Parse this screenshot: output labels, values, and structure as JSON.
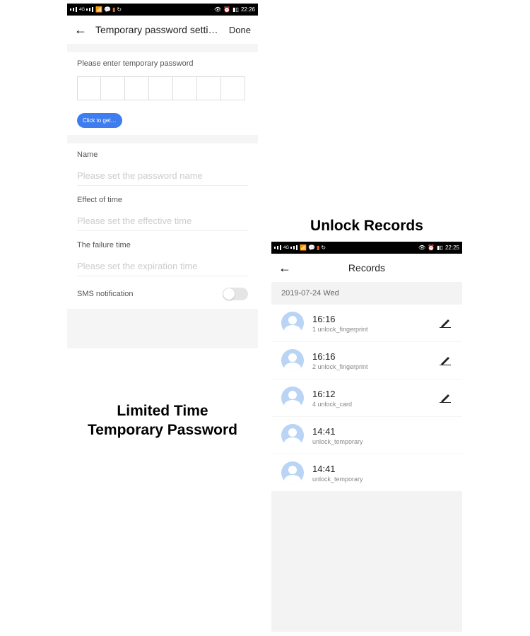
{
  "left": {
    "status": {
      "time": "22:26"
    },
    "nav": {
      "title": "Temporary password setti…",
      "done": "Done"
    },
    "prompt": "Please enter temporary password",
    "random_button": "Click to get a ran…",
    "fields": {
      "name_label": "Name",
      "name_placeholder": "Please set the password name",
      "effect_label": "Effect of time",
      "effect_placeholder": "Please set the effective time",
      "failure_label": "The failure time",
      "failure_placeholder": "Please set the expiration time",
      "sms_label": "SMS notification"
    },
    "caption": "Limited Time\nTemporary Password"
  },
  "right": {
    "caption": "Unlock Records",
    "status": {
      "time": "22:25"
    },
    "nav": {
      "title": "Records"
    },
    "date": "2019-07-24 Wed",
    "records": [
      {
        "time": "16:16",
        "type": "1 unlock_fingerprint",
        "editable": true
      },
      {
        "time": "16:16",
        "type": "2 unlock_fingerprint",
        "editable": true
      },
      {
        "time": "16:12",
        "type": "4 unlock_card",
        "editable": true
      },
      {
        "time": "14:41",
        "type": "unlock_temporary",
        "editable": false
      },
      {
        "time": "14:41",
        "type": "unlock_temporary",
        "editable": false
      }
    ]
  }
}
